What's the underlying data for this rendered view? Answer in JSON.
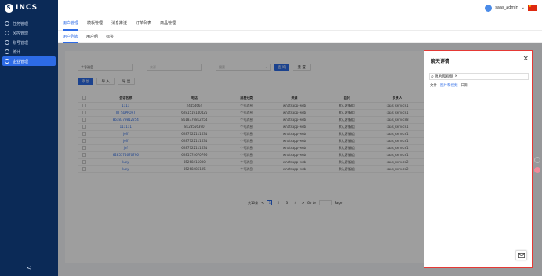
{
  "app": {
    "logo": "INCS"
  },
  "sidebar": {
    "items": [
      {
        "label": "任务管理",
        "icon": "task-icon"
      },
      {
        "label": "风控管理",
        "icon": "shield-icon"
      },
      {
        "label": "账号管理",
        "icon": "user-icon"
      },
      {
        "label": "统计",
        "icon": "chart-icon"
      },
      {
        "label": "企业管理",
        "icon": "enterprise-icon",
        "active": true
      }
    ],
    "collapse": "<"
  },
  "topbar": {
    "user": "saas_admin"
  },
  "tabs_primary": [
    "用户管理",
    "模板管理",
    "消息推送",
    "订单列表",
    "商品管理"
  ],
  "tabs_secondary": [
    "用户列表",
    "用户组",
    "标签"
  ],
  "filters": {
    "type_select": "个号消息",
    "select2_placeholder": "来源",
    "search_placeholder": "搜索",
    "query": "查 询",
    "reset": "重 置"
  },
  "actions": {
    "add": "添 加",
    "import": "导 入",
    "export": "导 出"
  },
  "table": {
    "headers": [
      "会话名称",
      "电话",
      "消息分类",
      "来源",
      "组织",
      "负责人"
    ],
    "rows": [
      [
        "1111",
        "24454664",
        "个号消息",
        "whatsapp-web",
        "默认客服组",
        "saas_service1"
      ],
      [
        "IIT SUPPORT",
        "6281519140425",
        "个号消息",
        "whatsapp-web",
        "默认客服组",
        "saas_service1"
      ],
      [
        "8618379812254",
        "8618379812254",
        "个号消息",
        "whatsapp-web",
        "默认客服组",
        "saas_service8"
      ],
      [
        "111111",
        "8128556390",
        "个号消息",
        "whatsapp-web",
        "默认客服组",
        "saas_service1"
      ],
      [
        "jeff",
        "6287722111631",
        "个号消息",
        "whatsapp-web",
        "默认客服组",
        "saas_service1"
      ],
      [
        "jeff",
        "6287722111631",
        "个号消息",
        "whatsapp-web",
        "默认客服组",
        "saas_service1"
      ],
      [
        "jef",
        "6287722111631",
        "个号消息",
        "whatsapp-web",
        "默认客服组",
        "saas_service1"
      ],
      [
        "6285574670796",
        "6285574670796",
        "个号消息",
        "whatsapp-web",
        "默认客服组",
        "saas_service1"
      ],
      [
        "lucy",
        "85268415000",
        "个号消息",
        "whatsapp-web",
        "默认客服组",
        "saas_service2"
      ],
      [
        "lucy",
        "85268486105",
        "个号消息",
        "whatsapp-web",
        "默认客服组",
        "saas_service2"
      ]
    ]
  },
  "pager": {
    "total": "共10条",
    "pages": [
      "1",
      "2",
      "3",
      "4"
    ],
    "goto": "Go to",
    "page": "Page",
    "prev": "<",
    "next": ">"
  },
  "drawer": {
    "title": "聊天详情",
    "search_tag": "图片和视频",
    "tabs": [
      "文件",
      "图片和视频",
      "日期"
    ],
    "active_tab": "图片和视频"
  },
  "colors": {
    "sidebar": "#0b2a57",
    "accent": "#2d6be6",
    "drawer_border": "#e53935"
  }
}
